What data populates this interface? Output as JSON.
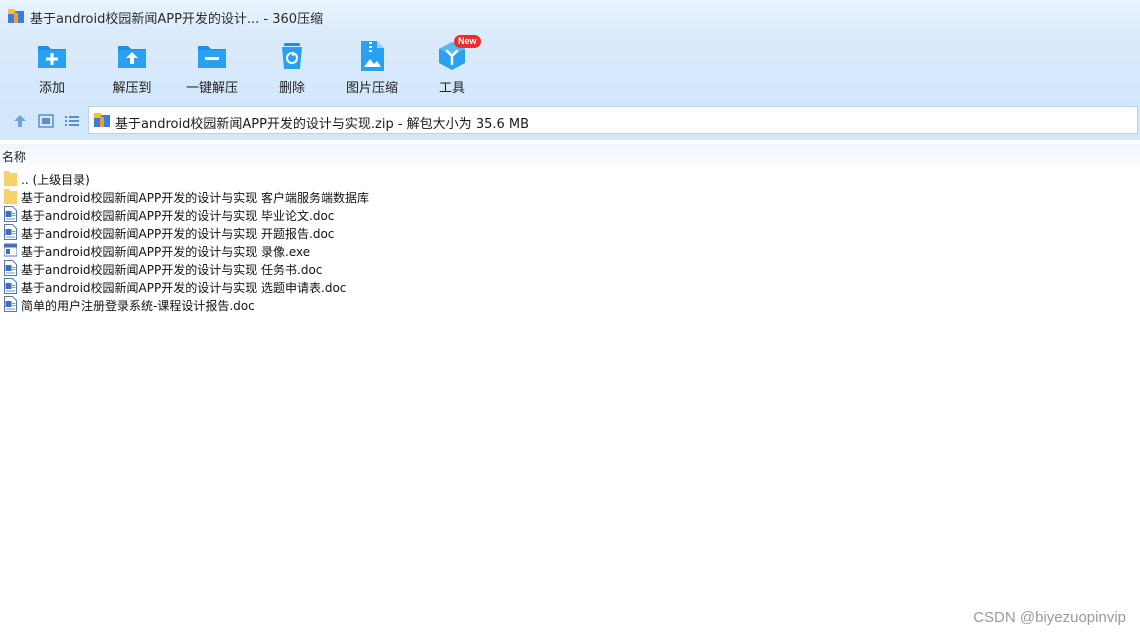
{
  "window": {
    "title": "基于android校园新闻APP开发的设计... - 360压缩"
  },
  "toolbar": {
    "buttons": [
      {
        "label": "添加",
        "icon": "add-icon"
      },
      {
        "label": "解压到",
        "icon": "extract-to-icon"
      },
      {
        "label": "一键解压",
        "icon": "one-click-extract-icon"
      },
      {
        "label": "删除",
        "icon": "delete-icon"
      },
      {
        "label": "图片压缩",
        "icon": "image-compress-icon"
      },
      {
        "label": "工具",
        "icon": "tools-icon",
        "badge": "New"
      }
    ]
  },
  "navigation": {
    "path": "基于android校园新闻APP开发的设计与实现.zip - 解包大小为 35.6 MB"
  },
  "filelist": {
    "column_header": "名称",
    "items": [
      {
        "name": ".. (上级目录)",
        "type": "folder"
      },
      {
        "name": "基于android校园新闻APP开发的设计与实现 客户端服务端数据库",
        "type": "folder"
      },
      {
        "name": "基于android校园新闻APP开发的设计与实现 毕业论文.doc",
        "type": "doc"
      },
      {
        "name": "基于android校园新闻APP开发的设计与实现 开题报告.doc",
        "type": "doc"
      },
      {
        "name": "基于android校园新闻APP开发的设计与实现 录像.exe",
        "type": "exe"
      },
      {
        "name": "基于android校园新闻APP开发的设计与实现 任务书.doc",
        "type": "doc"
      },
      {
        "name": "基于android校园新闻APP开发的设计与实现 选题申请表.doc",
        "type": "doc"
      },
      {
        "name": "简单的用户注册登录系统-课程设计报告.doc",
        "type": "doc"
      }
    ]
  },
  "watermark": "CSDN @biyezuopinvip",
  "colors": {
    "accent": "#1e90e8",
    "toolbar_bg": "#d3e7fb",
    "folder": "#f7d26b",
    "badge": "#e5302d"
  }
}
